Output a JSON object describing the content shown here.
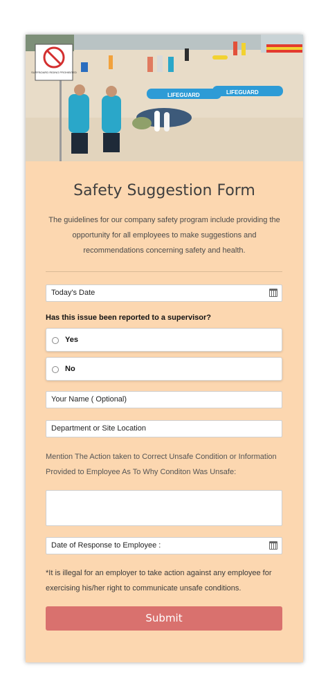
{
  "hero": {
    "sign_text": "SURFBOARD RIDING PROHIBITED",
    "board_text_1": "LIFEGUARD",
    "board_text_2": "LIFEGUARD"
  },
  "form": {
    "title": "Safety Suggestion Form",
    "intro": "The guidelines for our company safety program include providing the opportunity for all employees to make suggestions and recommendations concerning safety and health.",
    "todays_date_placeholder": "Today's Date",
    "question_reported": "Has this issue been reported to a supervisor?",
    "options": [
      "Yes",
      "No"
    ],
    "name_placeholder": "Your Name ( Optional)",
    "department_placeholder": "Department or Site Location",
    "action_label": "Mention The Action taken to Correct Unsafe Condition or Information Provided to Employee As To Why Conditon Was Unsafe:",
    "response_date_placeholder": "Date of Response to Employee :",
    "legal_note": "*It is illegal for an employer to take action against any employee for exercising his/her right to communicate unsafe conditions.",
    "submit_label": "Submit"
  },
  "colors": {
    "card_background": "#fcd7b0",
    "submit_button": "#d9716e"
  }
}
